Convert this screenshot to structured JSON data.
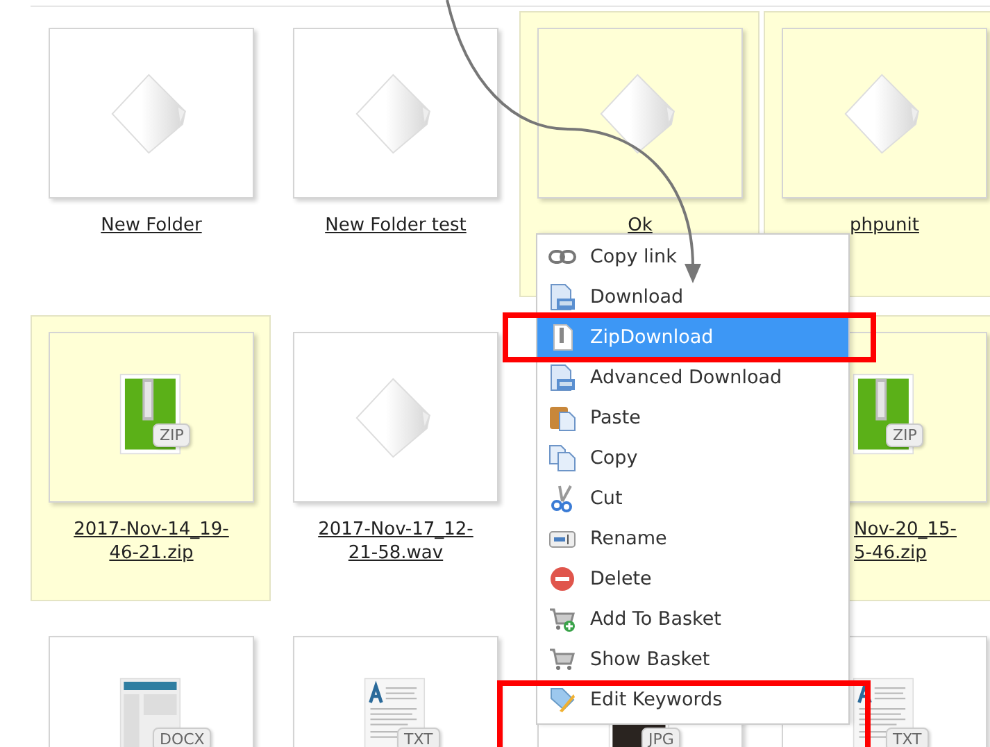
{
  "rows": [
    {
      "tiles": [
        {
          "kind": "generic",
          "label_lines": [
            "New Folder"
          ],
          "selected": false
        },
        {
          "kind": "generic",
          "label_lines": [
            "New Folder test"
          ],
          "selected": false
        },
        {
          "kind": "generic",
          "label_lines": [
            "Ok"
          ],
          "selected": true
        },
        {
          "kind": "generic",
          "label_lines": [
            "phpunit"
          ],
          "selected": true
        }
      ]
    },
    {
      "tiles": [
        {
          "kind": "zip",
          "badge": "ZIP",
          "label_lines": [
            "2017-Nov-14_19-",
            "46-21.zip"
          ],
          "selected": true
        },
        {
          "kind": "generic",
          "label_lines": [
            "2017-Nov-17_12-",
            "21-58.wav"
          ],
          "selected": false
        },
        {
          "kind": "zip",
          "badge": "ZIP",
          "label_lines": [
            "Nov-20_15-",
            "5-46.zip"
          ],
          "label_cut": true,
          "selected": true
        }
      ]
    },
    {
      "tiles": [
        {
          "kind": "docx",
          "badge": "DOCX",
          "selected": false
        },
        {
          "kind": "txt",
          "badge": "TXT",
          "selected": false
        },
        {
          "kind": "jpg",
          "badge": "JPG",
          "selected": false
        },
        {
          "kind": "txt",
          "badge": "TXT",
          "selected": false
        }
      ]
    }
  ],
  "context_menu": {
    "items": [
      {
        "kind": "link",
        "label": "Copy link",
        "selected": false
      },
      {
        "kind": "download",
        "label": "Download",
        "selected": false
      },
      {
        "kind": "zip",
        "label": "ZipDownload",
        "selected": true
      },
      {
        "kind": "download",
        "label": "Advanced Download",
        "selected": false
      },
      {
        "kind": "paste",
        "label": "Paste",
        "selected": false
      },
      {
        "kind": "copy",
        "label": "Copy",
        "selected": false
      },
      {
        "kind": "cut",
        "label": "Cut",
        "selected": false
      },
      {
        "kind": "rename",
        "label": "Rename",
        "selected": false
      },
      {
        "kind": "delete",
        "label": "Delete",
        "selected": false
      },
      {
        "kind": "cart-add",
        "label": "Add To Basket",
        "selected": false
      },
      {
        "kind": "cart",
        "label": "Show Basket",
        "selected": false
      },
      {
        "kind": "tag",
        "label": "Edit Keywords",
        "selected": false
      }
    ]
  }
}
